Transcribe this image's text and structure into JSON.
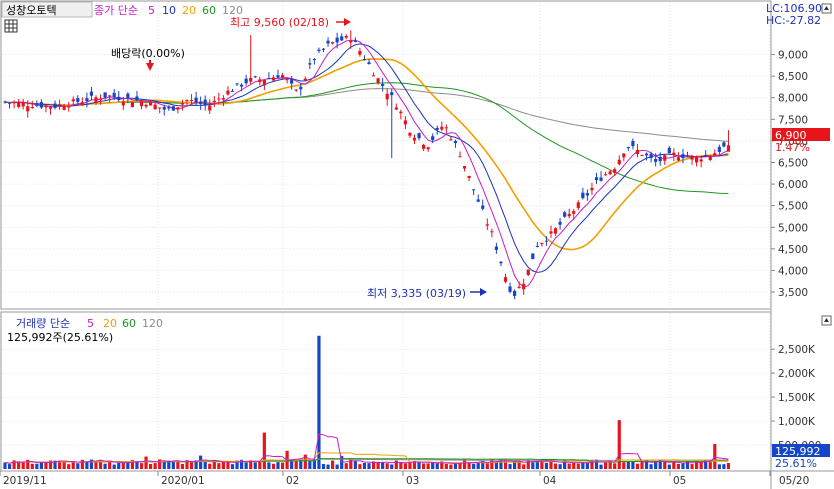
{
  "price_header": {
    "stock_name": "성창오토텍",
    "indicator_label": "종가 단순",
    "ma_periods": [
      "5",
      "10",
      "20",
      "60",
      "120"
    ]
  },
  "price_readouts": {
    "lc": "LC:106.90",
    "hc": "HC:-27.82",
    "current_price": "6,900",
    "change_pct": "1.47%"
  },
  "annotations": {
    "dividend": "배당락(0.00%)",
    "high": "최고 9,560 (02/18)",
    "low": "최저 3,335 (03/19)"
  },
  "volume_header": {
    "label": "거래량 단순",
    "ma_periods": [
      "5",
      "20",
      "60",
      "120"
    ],
    "current_volume": "125,992주(25.61%)"
  },
  "volume_readouts": {
    "current_volume": "125,992",
    "pct": "25.61%"
  },
  "colors": {
    "up": "#e8141c",
    "down": "#1646c8",
    "ma5": "#c81ec8",
    "ma10": "#1e32b4",
    "ma20": "#f0a000",
    "ma60": "#1e961e",
    "ma120": "#8c8c8c"
  },
  "chart_data": [
    {
      "type": "candlestick",
      "y_ticks": [
        "9,000",
        "8,500",
        "8,000",
        "7,500",
        "7,000",
        "6,500",
        "6,000",
        "5,500",
        "5,000",
        "4,500",
        "4,000",
        "3,500"
      ],
      "ylim": [
        3200,
        9800
      ],
      "x_ticks": [
        "2019/11",
        "2020/01",
        "02",
        "03",
        "04",
        "05",
        "05/20"
      ],
      "moving_averages": [
        "5",
        "10",
        "20",
        "60",
        "120"
      ],
      "anchors": {
        "high": {
          "date": "02/18",
          "value": 9560
        },
        "low": {
          "date": "03/19",
          "value": 3335
        },
        "last": {
          "value": 6900
        }
      }
    },
    {
      "type": "bar",
      "y_ticks": [
        "2,500K",
        "2,000K",
        "1,500K",
        "1,000K",
        "500,000"
      ],
      "ylim": [
        0,
        2900000
      ],
      "moving_averages": [
        "5",
        "20",
        "60",
        "120"
      ],
      "last": 125992
    }
  ]
}
